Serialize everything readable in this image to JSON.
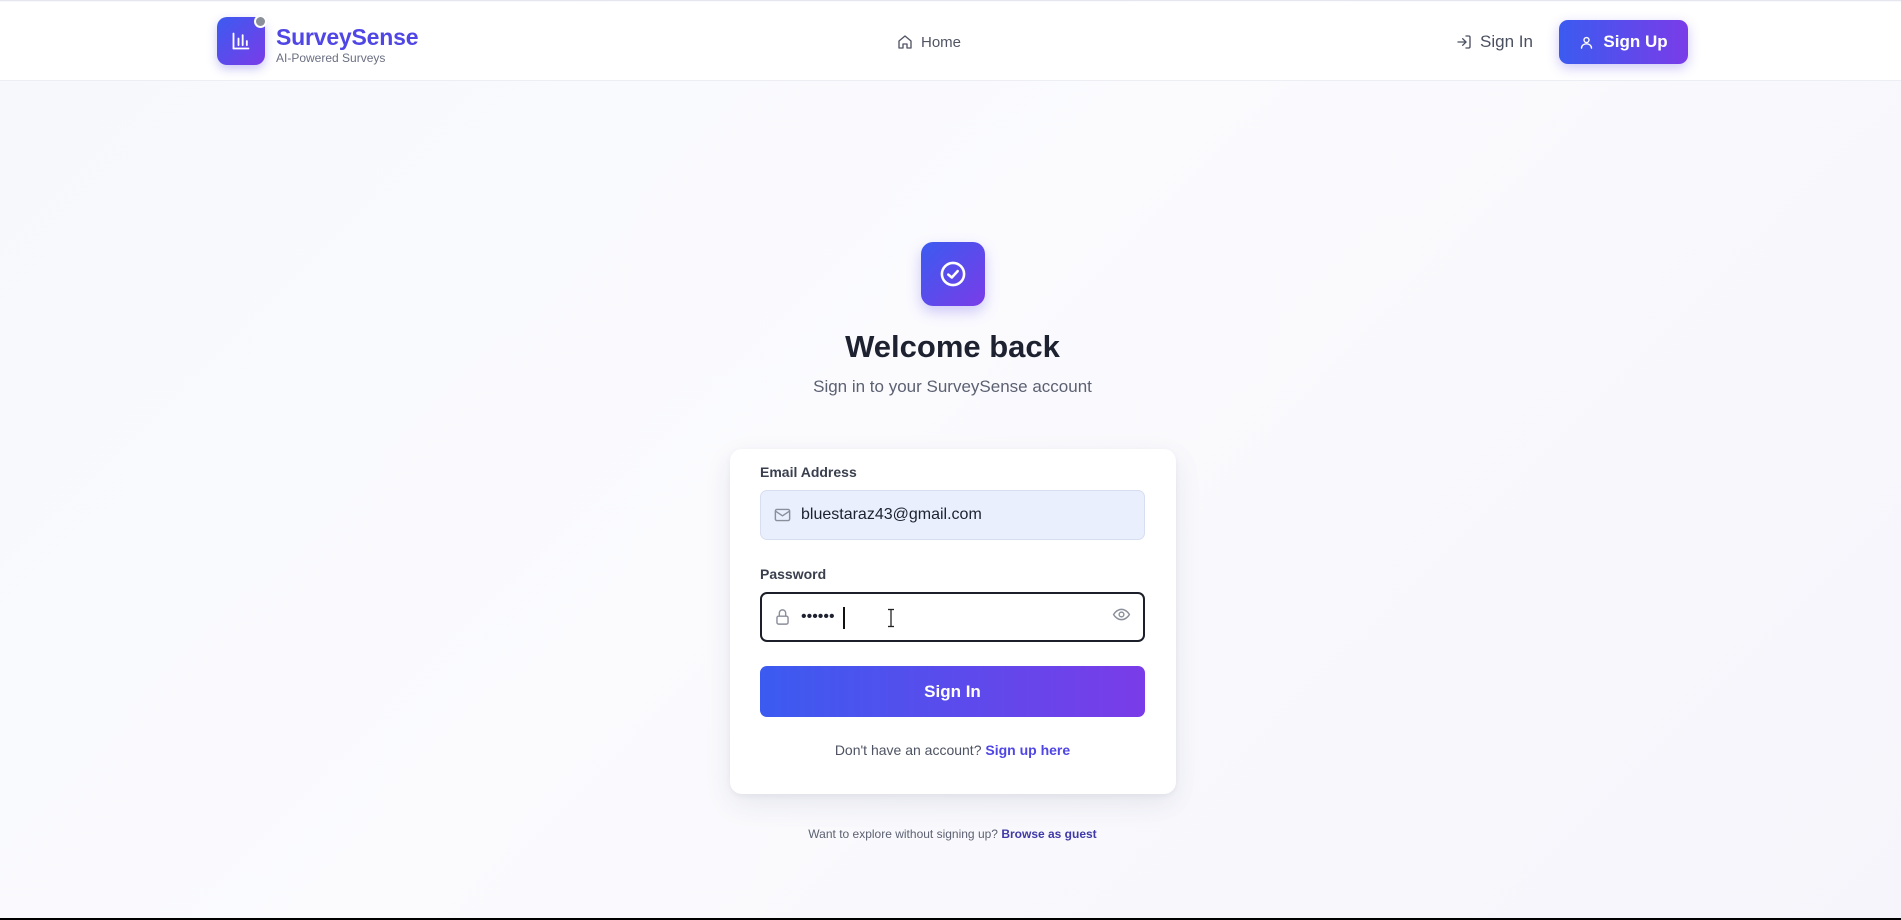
{
  "brand": {
    "name": "SurveySense",
    "tagline": "AI-Powered Surveys",
    "logo_icon": "bar-chart-icon"
  },
  "nav": {
    "home_label": "Home",
    "signin_label": "Sign In",
    "signup_label": "Sign Up"
  },
  "hero": {
    "icon": "check-circle-icon",
    "title": "Welcome back",
    "subtitle": "Sign in to your SurveySense account"
  },
  "form": {
    "email_label": "Email Address",
    "email_value": "bluestaraz43@gmail.com",
    "password_label": "Password",
    "password_value": "••••••",
    "submit_label": "Sign In"
  },
  "footer": {
    "no_account_text": "Don't have an account?",
    "signup_link": "Sign up here",
    "guest_text": "Want to explore without signing up?",
    "guest_link": "Browse as guest"
  },
  "colors": {
    "accent_start": "#3b5bf0",
    "accent_end": "#7a3ce8",
    "brand_text": "#4f46e5"
  }
}
